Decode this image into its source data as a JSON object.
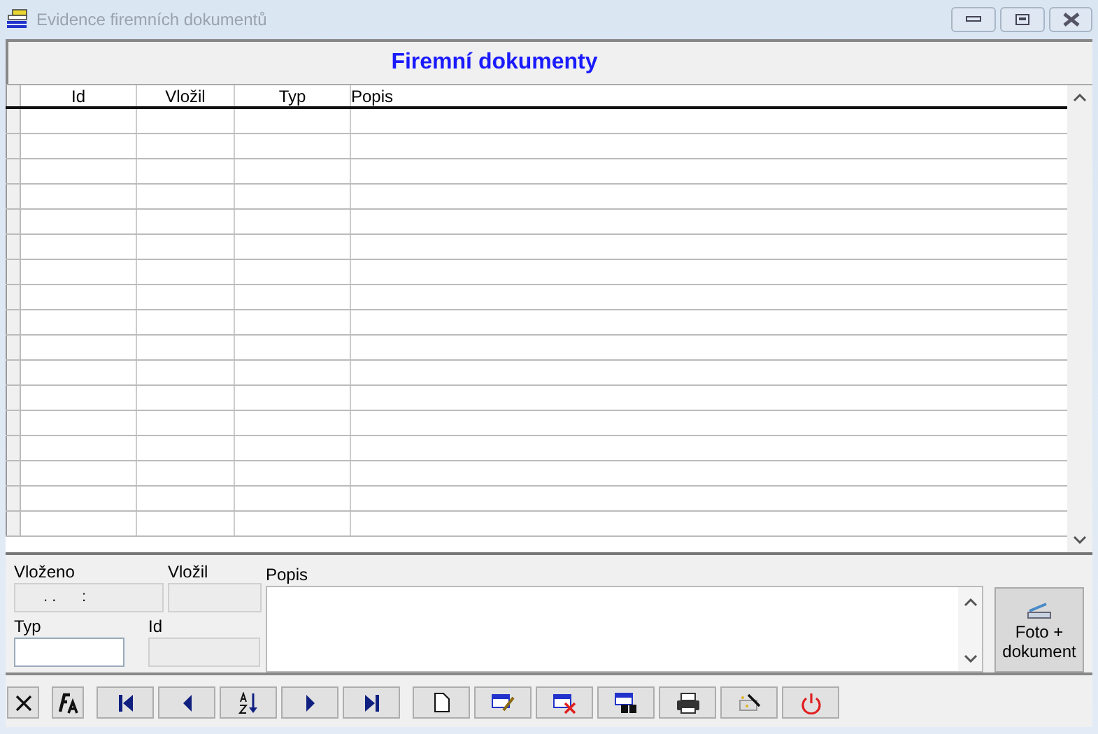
{
  "window": {
    "title": "Evidence firemních dokumentů"
  },
  "header": {
    "title": "Firemní dokumenty"
  },
  "table": {
    "columns": [
      "Id",
      "Vložil",
      "Typ",
      "Popis"
    ]
  },
  "form": {
    "vlozeno_label": "Vloženo",
    "vlozeno_value": ". .      :",
    "vlozil_label": "Vložil",
    "popis_label": "Popis",
    "typ_label": "Typ",
    "id_label": "Id"
  },
  "photo_button": {
    "label": "Foto + dokument"
  }
}
